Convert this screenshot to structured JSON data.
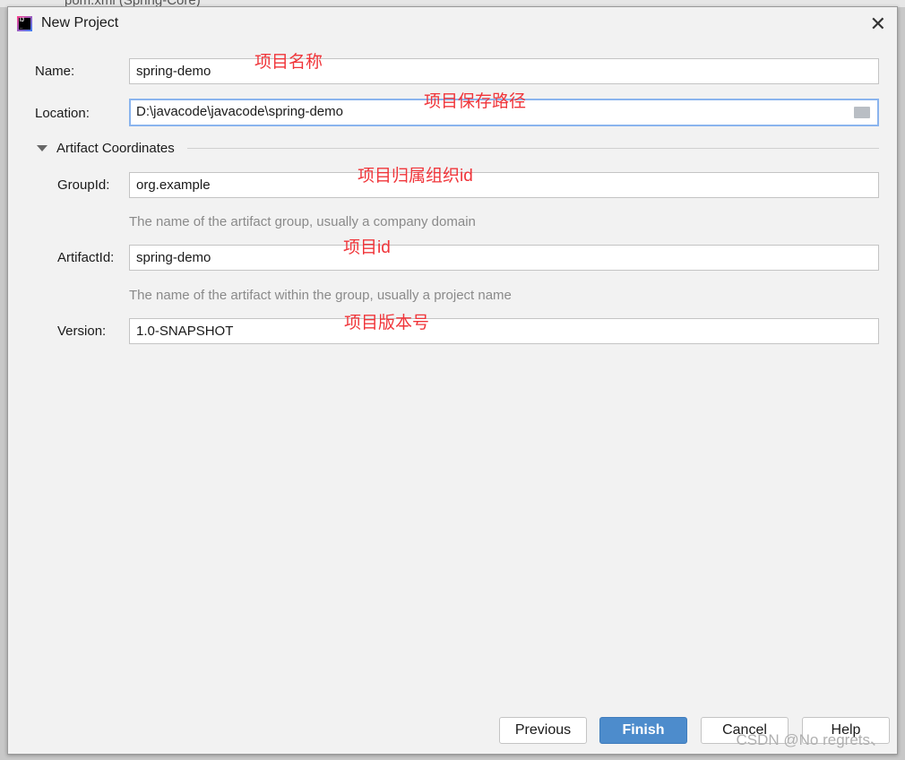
{
  "background_tab": "pom.xml (Spring-Core)",
  "dialog": {
    "title": "New Project"
  },
  "form": {
    "name_label": "Name:",
    "name_value": "spring-demo",
    "location_label": "Location:",
    "location_value": "D:\\javacode\\javacode\\spring-demo",
    "section_title": "Artifact Coordinates",
    "groupid_label": "GroupId:",
    "groupid_value": "org.example",
    "groupid_hint": "The name of the artifact group, usually a company domain",
    "artifactid_label": "ArtifactId:",
    "artifactid_value": "spring-demo",
    "artifactid_hint": "The name of the artifact within the group, usually a project name",
    "version_label": "Version:",
    "version_value": "1.0-SNAPSHOT"
  },
  "annotations": {
    "name": "项目名称",
    "location": "项目保存路径",
    "groupid": "项目归属组织id",
    "artifactid": "项目id",
    "version": "项目版本号"
  },
  "buttons": {
    "previous": "Previous",
    "finish": "Finish",
    "cancel": "Cancel",
    "help": "Help"
  },
  "watermark": "CSDN @No regrets、",
  "colors": {
    "primary_button": "#4d8ccc",
    "annotation": "#f0353a",
    "focus_border": "#8ab4ee"
  }
}
